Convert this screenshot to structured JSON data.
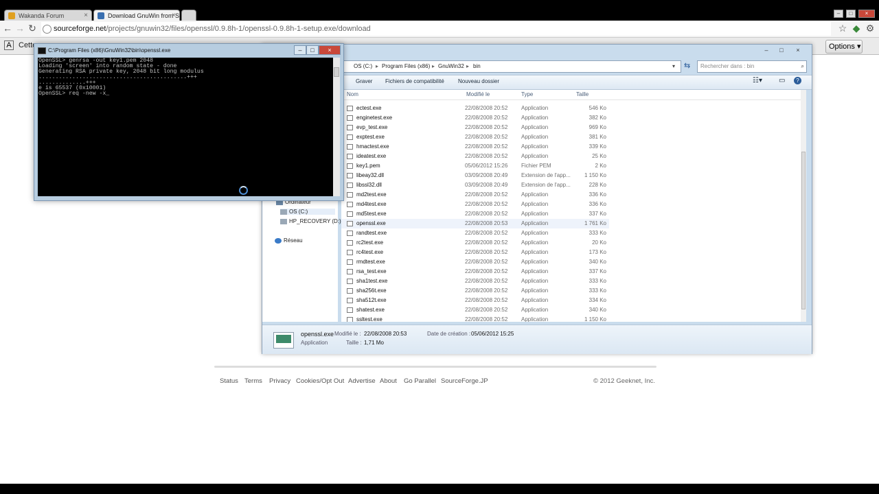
{
  "browser": {
    "tabs": [
      {
        "label": "Wakanda Forum",
        "active": false
      },
      {
        "label": "Download GnuWin from So",
        "active": true
      }
    ],
    "url_host": "sourceforge.net",
    "url_path": "/projects/gnuwin32/files/openssl/0.9.8h-1/openssl-0.9.8h-1-setup.exe/download",
    "infobar_text": "Cette",
    "options_label": "Options ▾"
  },
  "footer": {
    "links": [
      "Status",
      "Terms",
      "Privacy",
      "Cookies/Opt Out",
      "Advertise",
      "About",
      "Go Parallel",
      "SourceForge.JP"
    ],
    "copyright": "© 2012 Geeknet, Inc."
  },
  "cmd_window": {
    "title": "C:\\Program Files (x86)\\GnuWin32\\bin\\openssl.exe",
    "console_text": "OpenSSL> genrsa -out key1.pem 2048\nLoading 'screen' into random state - done\nGenerating RSA private key, 2048 bit long modulus\n............................................+++\n..............+++\ne is 65537 (0x10001)\nOpenSSL> req -new -x_"
  },
  "explorer": {
    "breadcrumb": [
      "OS (C:)",
      "Program Files (x86)",
      "GnuWin32",
      "bin"
    ],
    "search_placeholder": "Rechercher dans : bin",
    "commands": [
      "Graver",
      "Fichiers de compatibilité",
      "Nouveau dossier"
    ],
    "columns": [
      "Nom",
      "Modifié le",
      "Type",
      "Taille"
    ],
    "nav_items": [
      "Ordinateur",
      "OS (C:)",
      "HP_RECOVERY (D:)",
      "Réseau"
    ],
    "files": [
      {
        "name": "ectest.exe",
        "date": "22/08/2008 20:52",
        "type": "Application",
        "size": "546 Ko"
      },
      {
        "name": "enginetest.exe",
        "date": "22/08/2008 20:52",
        "type": "Application",
        "size": "382 Ko"
      },
      {
        "name": "evp_test.exe",
        "date": "22/08/2008 20:52",
        "type": "Application",
        "size": "969 Ko"
      },
      {
        "name": "exptest.exe",
        "date": "22/08/2008 20:52",
        "type": "Application",
        "size": "381 Ko"
      },
      {
        "name": "hmactest.exe",
        "date": "22/08/2008 20:52",
        "type": "Application",
        "size": "339 Ko"
      },
      {
        "name": "ideatest.exe",
        "date": "22/08/2008 20:52",
        "type": "Application",
        "size": "25 Ko"
      },
      {
        "name": "key1.pem",
        "date": "05/06/2012 15:26",
        "type": "Fichier PEM",
        "size": "2 Ko"
      },
      {
        "name": "libeay32.dll",
        "date": "03/09/2008 20:49",
        "type": "Extension de l'app...",
        "size": "1 150 Ko"
      },
      {
        "name": "libssl32.dll",
        "date": "03/09/2008 20:49",
        "type": "Extension de l'app...",
        "size": "228 Ko"
      },
      {
        "name": "md2test.exe",
        "date": "22/08/2008 20:52",
        "type": "Application",
        "size": "336 Ko"
      },
      {
        "name": "md4test.exe",
        "date": "22/08/2008 20:52",
        "type": "Application",
        "size": "336 Ko"
      },
      {
        "name": "md5test.exe",
        "date": "22/08/2008 20:52",
        "type": "Application",
        "size": "337 Ko"
      },
      {
        "name": "openssl.exe",
        "date": "22/08/2008 20:53",
        "type": "Application",
        "size": "1 761 Ko",
        "selected": true
      },
      {
        "name": "randtest.exe",
        "date": "22/08/2008 20:52",
        "type": "Application",
        "size": "333 Ko"
      },
      {
        "name": "rc2test.exe",
        "date": "22/08/2008 20:52",
        "type": "Application",
        "size": "20 Ko"
      },
      {
        "name": "rc4test.exe",
        "date": "22/08/2008 20:52",
        "type": "Application",
        "size": "173 Ko"
      },
      {
        "name": "rmdtest.exe",
        "date": "22/08/2008 20:52",
        "type": "Application",
        "size": "340 Ko"
      },
      {
        "name": "rsa_test.exe",
        "date": "22/08/2008 20:52",
        "type": "Application",
        "size": "337 Ko"
      },
      {
        "name": "sha1test.exe",
        "date": "22/08/2008 20:52",
        "type": "Application",
        "size": "333 Ko"
      },
      {
        "name": "sha256t.exe",
        "date": "22/08/2008 20:52",
        "type": "Application",
        "size": "333 Ko"
      },
      {
        "name": "sha512t.exe",
        "date": "22/08/2008 20:52",
        "type": "Application",
        "size": "334 Ko"
      },
      {
        "name": "shatest.exe",
        "date": "22/08/2008 20:52",
        "type": "Application",
        "size": "340 Ko"
      },
      {
        "name": "ssltest.exe",
        "date": "22/08/2008 20:52",
        "type": "Application",
        "size": "1 150 Ko"
      }
    ],
    "details": {
      "name": "openssl.exe",
      "modified_label": "Modifié le :",
      "modified_value": "22/08/2008 20:53",
      "created_label": "Date de création :",
      "created_value": "05/06/2012 15:25",
      "type": "Application",
      "size_label": "Taille :",
      "size_value": "1,71 Mo"
    }
  }
}
